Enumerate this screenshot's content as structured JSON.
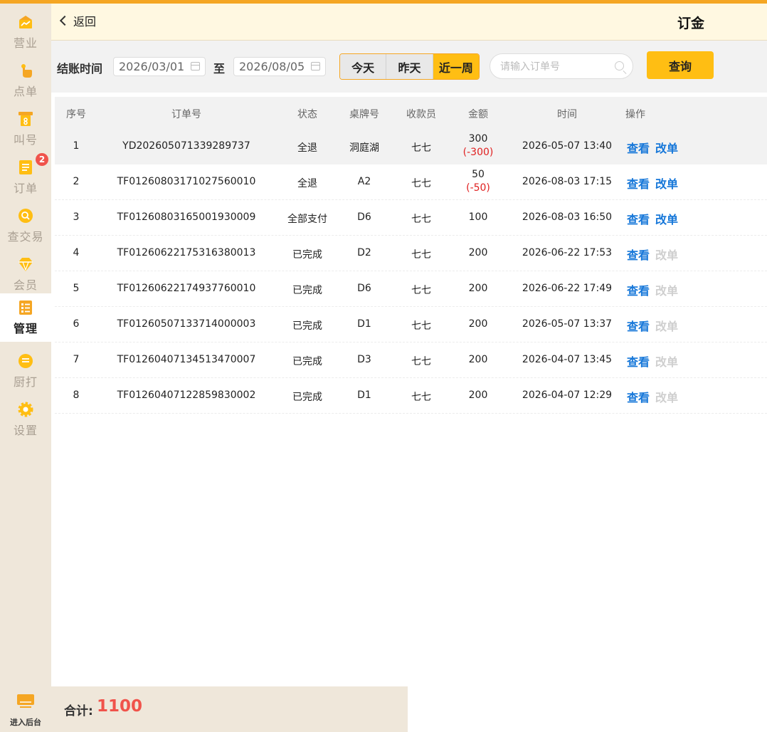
{
  "sidebar": {
    "items": [
      {
        "label": "营业",
        "icon": "shop-icon"
      },
      {
        "label": "点单",
        "icon": "hand-pointer-icon"
      },
      {
        "label": "叫号",
        "icon": "queue-number-icon"
      },
      {
        "label": "订单",
        "icon": "order-list-icon",
        "badge": "2"
      },
      {
        "label": "查交易",
        "icon": "search-transaction-icon"
      },
      {
        "label": "会员",
        "icon": "member-diamond-icon"
      },
      {
        "label": "管理",
        "icon": "management-icon",
        "active": true
      },
      {
        "label": "厨打",
        "icon": "kitchen-print-icon"
      },
      {
        "label": "设置",
        "icon": "gear-icon"
      }
    ],
    "backend_label": "进入后台"
  },
  "header": {
    "back_label": "返回",
    "title": "订金"
  },
  "filter": {
    "label": "结账时间",
    "start_date": "2026/03/01",
    "to_label": "至",
    "end_date": "2026/08/05",
    "quick_ranges": [
      "今天",
      "昨天",
      "近一周"
    ],
    "selected_range": "近一周",
    "search_placeholder": "请输入订单号",
    "query_label": "查询"
  },
  "table": {
    "headers": [
      "序号",
      "订单号",
      "状态",
      "桌牌号",
      "收款员",
      "金额",
      "时间",
      "操作"
    ],
    "rows": [
      {
        "no": "1",
        "order": "YD202605071339289737",
        "status": "全退",
        "table": "洞庭湖",
        "cashier": "七七",
        "amount": "300",
        "refund": "(-300)",
        "time": "2026-05-07 13:40",
        "view": "查看",
        "edit": "改单",
        "edit_enabled": true
      },
      {
        "no": "2",
        "order": "TF01260803171027560010",
        "status": "全退",
        "table": "A2",
        "cashier": "七七",
        "amount": "50",
        "refund": "(-50)",
        "time": "2026-08-03 17:15",
        "view": "查看",
        "edit": "改单",
        "edit_enabled": true
      },
      {
        "no": "3",
        "order": "TF01260803165001930009",
        "status": "全部支付",
        "table": "D6",
        "cashier": "七七",
        "amount": "100",
        "refund": "",
        "time": "2026-08-03 16:50",
        "view": "查看",
        "edit": "改单",
        "edit_enabled": true
      },
      {
        "no": "4",
        "order": "TF01260622175316380013",
        "status": "已完成",
        "table": "D2",
        "cashier": "七七",
        "amount": "200",
        "refund": "",
        "time": "2026-06-22 17:53",
        "view": "查看",
        "edit": "改单",
        "edit_enabled": false
      },
      {
        "no": "5",
        "order": "TF01260622174937760010",
        "status": "已完成",
        "table": "D6",
        "cashier": "七七",
        "amount": "200",
        "refund": "",
        "time": "2026-06-22 17:49",
        "view": "查看",
        "edit": "改单",
        "edit_enabled": false
      },
      {
        "no": "6",
        "order": "TF01260507133714000003",
        "status": "已完成",
        "table": "D1",
        "cashier": "七七",
        "amount": "200",
        "refund": "",
        "time": "2026-05-07 13:37",
        "view": "查看",
        "edit": "改单",
        "edit_enabled": false
      },
      {
        "no": "7",
        "order": "TF01260407134513470007",
        "status": "已完成",
        "table": "D3",
        "cashier": "七七",
        "amount": "200",
        "refund": "",
        "time": "2026-04-07 13:45",
        "view": "查看",
        "edit": "改单",
        "edit_enabled": false
      },
      {
        "no": "8",
        "order": "TF01260407122859830002",
        "status": "已完成",
        "table": "D1",
        "cashier": "七七",
        "amount": "200",
        "refund": "",
        "time": "2026-04-07 12:29",
        "view": "查看",
        "edit": "改单",
        "edit_enabled": false
      }
    ]
  },
  "footer": {
    "total_label": "合计:",
    "total_value": "1100"
  },
  "colors": {
    "accent": "#ffbe13",
    "accent_dark": "#f5a623",
    "link": "#1677d9",
    "negative": "#e02020",
    "badge": "#f0534b",
    "sidebar_bg": "#efe7da"
  }
}
